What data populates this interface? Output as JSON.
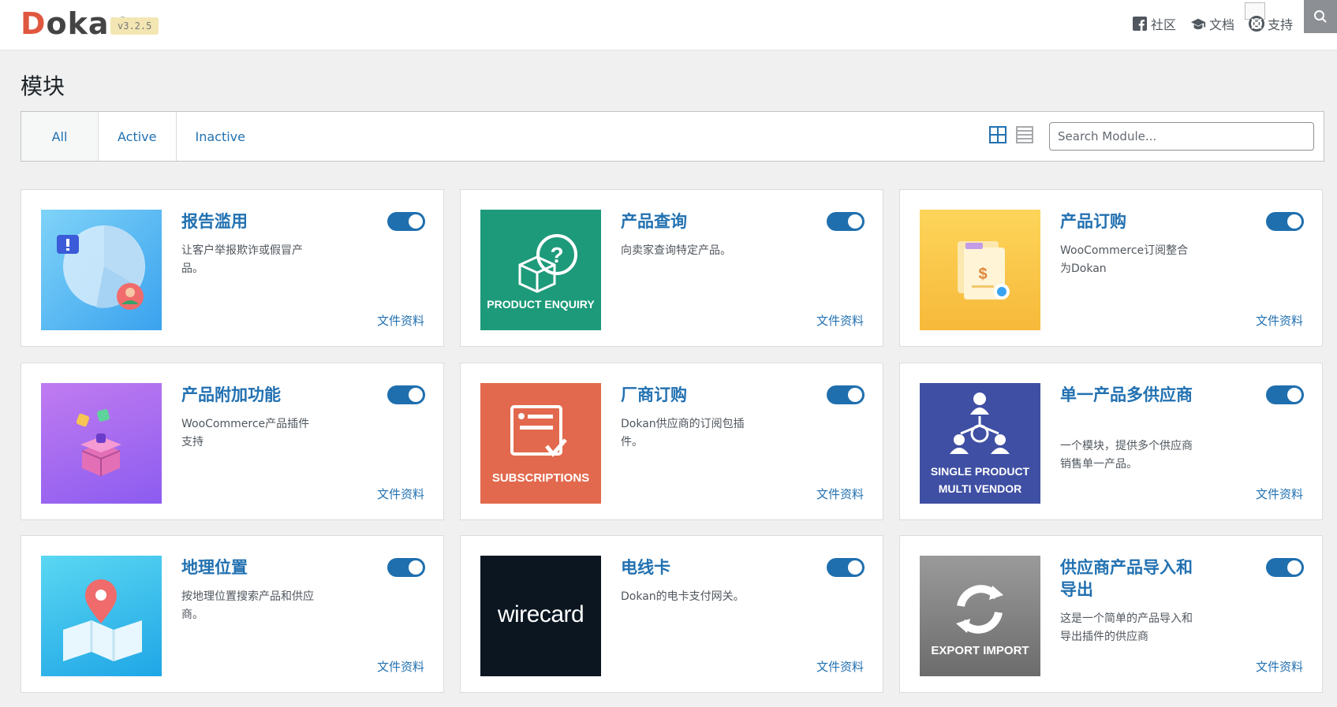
{
  "header": {
    "logo_first": "D",
    "logo_rest": "okan",
    "version": "v3.2.5",
    "links": [
      {
        "icon": "facebook-icon",
        "label": "社区"
      },
      {
        "icon": "graduation-cap-icon",
        "label": "文档"
      },
      {
        "icon": "lifebuoy-icon",
        "label": "支持"
      }
    ]
  },
  "page": {
    "title": "模块"
  },
  "filter": {
    "tabs": [
      "All",
      "Active",
      "Inactive"
    ],
    "active_tab": "All",
    "search_placeholder": "Search Module..."
  },
  "modules": [
    {
      "title": "报告滥用",
      "desc": "让客户举报欺诈或假冒产品。",
      "doc": "文件资料",
      "enabled": true,
      "thumb_text": ""
    },
    {
      "title": "产品查询",
      "desc": "向卖家查询特定产品。",
      "doc": "文件资料",
      "enabled": true,
      "thumb_text": "PRODUCT ENQUIRY"
    },
    {
      "title": "产品订购",
      "desc": "WooCommerce订阅整合为Dokan",
      "doc": "文件资料",
      "enabled": true,
      "thumb_text": ""
    },
    {
      "title": "产品附加功能",
      "desc": "WooCommerce产品插件支持",
      "doc": "文件资料",
      "enabled": true,
      "thumb_text": ""
    },
    {
      "title": "厂商订购",
      "desc": "Dokan供应商的订阅包插件。",
      "doc": "文件资料",
      "enabled": true,
      "thumb_text": "SUBSCRIPTIONS"
    },
    {
      "title": "单一产品多供应商",
      "desc": "一个模块，提供多个供应商销售单一产品。",
      "doc": "文件资料",
      "enabled": true,
      "thumb_text_1": "SINGLE PRODUCT",
      "thumb_text_2": "MULTI VENDOR"
    },
    {
      "title": "地理位置",
      "desc": "按地理位置搜索产品和供应商。",
      "doc": "文件资料",
      "enabled": true,
      "thumb_text": ""
    },
    {
      "title": "电线卡",
      "desc": "Dokan的电卡支付网关。",
      "doc": "文件资料",
      "enabled": true,
      "thumb_text": "wirecard"
    },
    {
      "title": "供应商产品导入和导出",
      "desc": "这是一个简单的产品导入和导出插件的供应商",
      "doc": "文件资料",
      "enabled": true,
      "thumb_text": "EXPORT IMPORT"
    }
  ],
  "colors": {
    "accent": "#2271b1",
    "toggle_on": "#1f6fae",
    "logo_red": "#e0573f"
  }
}
